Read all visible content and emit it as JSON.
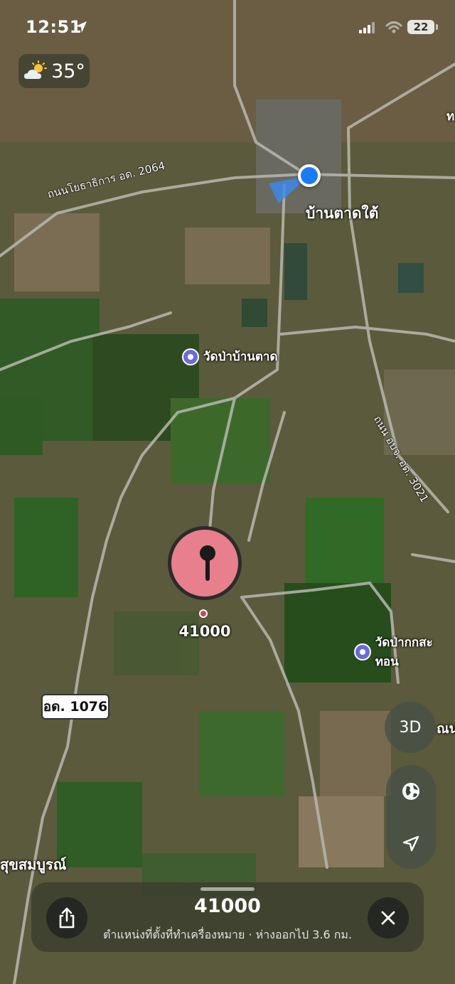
{
  "status_bar": {
    "time": "12:51",
    "battery": "22",
    "icons": [
      "location-arrow-icon",
      "signal-icon",
      "wifi-icon",
      "battery-icon"
    ]
  },
  "weather": {
    "temperature": "35°",
    "icon": "partly-sunny-icon"
  },
  "map": {
    "type": "satellite",
    "places": [
      {
        "name": "บ้านตาดใต้"
      },
      {
        "name": "สุขสมบูรณ์"
      },
      {
        "name": "ท"
      },
      {
        "name": "ณน"
      }
    ],
    "roads": [
      {
        "name": "ถนนโยธาธิการ อด. 2064"
      },
      {
        "name": "ถนน อบจ. อด. 3021"
      },
      {
        "name": "อด. 1076"
      }
    ],
    "pois": [
      {
        "name": "วัดป่าบ้านตาด"
      },
      {
        "name": "วัดป่ากกสะทอน"
      }
    ],
    "pin_label": "41000"
  },
  "controls": {
    "view_3d_label": "3D",
    "globe_icon": "globe-icon",
    "location_icon": "location-arrow-icon"
  },
  "sheet": {
    "title": "41000",
    "subtitle": "ตำแหน่งที่ตั้งที่ทำเครื่องหมาย · ห่างออกไป 3.6 กม.",
    "share_icon": "share-icon",
    "close_icon": "close-icon"
  },
  "colors": {
    "user_location": "#1a7cf5",
    "pin": "#e77f8c",
    "poi": "#6b6ad8"
  }
}
